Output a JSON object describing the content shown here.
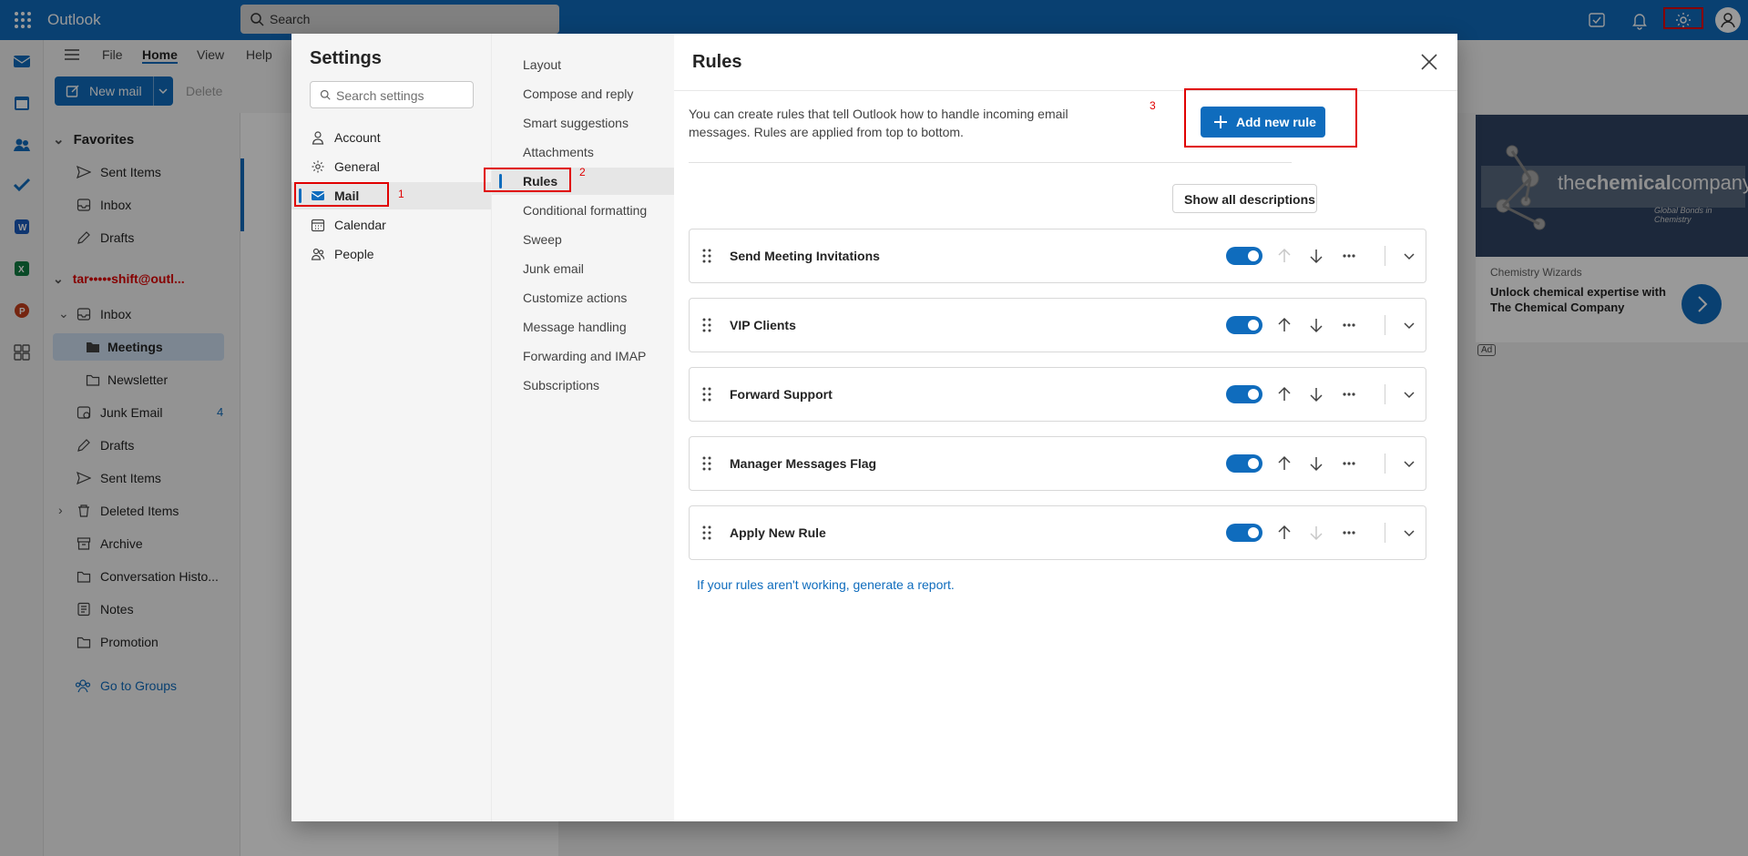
{
  "app": {
    "name": "Outlook",
    "search_placeholder": "Search"
  },
  "ribbon": {
    "tabs": [
      "File",
      "Home",
      "View",
      "Help"
    ],
    "new_mail": "New mail",
    "delete": "Delete"
  },
  "folders": {
    "favorites_label": "Favorites",
    "favorites": [
      "Sent Items",
      "Inbox",
      "Drafts"
    ],
    "account_label": "tar•••••shift@outl...",
    "items": [
      {
        "label": "Inbox",
        "icon": "inbox-icon"
      },
      {
        "label": "Meetings",
        "icon": "folder-icon",
        "selected": true
      },
      {
        "label": "Newsletter",
        "icon": "folder-icon"
      },
      {
        "label": "Junk Email",
        "icon": "junk-icon",
        "count": "4"
      },
      {
        "label": "Drafts",
        "icon": "pencil-icon"
      },
      {
        "label": "Sent Items",
        "icon": "send-icon"
      },
      {
        "label": "Deleted Items",
        "icon": "trash-icon"
      },
      {
        "label": "Archive",
        "icon": "archive-icon"
      },
      {
        "label": "Conversation Histo...",
        "icon": "folder-icon"
      },
      {
        "label": "Notes",
        "icon": "notes-icon"
      },
      {
        "label": "Promotion",
        "icon": "folder-icon"
      }
    ],
    "go_to_groups": "Go to Groups"
  },
  "ad": {
    "brand_light": "the",
    "brand_bold": "chemical",
    "brand_tail": "company",
    "tagline": "Global Bonds in Chemistry",
    "source": "Chemistry Wizards",
    "headline": "Unlock chemical expertise with The Chemical Company",
    "badge": "Ad"
  },
  "settings": {
    "title": "Settings",
    "search_placeholder": "Search settings",
    "categories": [
      {
        "label": "Account",
        "icon": "person-icon"
      },
      {
        "label": "General",
        "icon": "gear-icon"
      },
      {
        "label": "Mail",
        "icon": "mail-icon",
        "selected": true
      },
      {
        "label": "Calendar",
        "icon": "calendar-icon"
      },
      {
        "label": "People",
        "icon": "people-icon"
      }
    ],
    "mail_sections": [
      "Layout",
      "Compose and reply",
      "Smart suggestions",
      "Attachments",
      "Rules",
      "Conditional formatting",
      "Sweep",
      "Junk email",
      "Customize actions",
      "Message handling",
      "Forwarding and IMAP",
      "Subscriptions"
    ],
    "selected_section": "Rules"
  },
  "rules": {
    "title": "Rules",
    "description": "You can create rules that tell Outlook how to handle incoming email messages. Rules are applied from top to bottom.",
    "add_button": "Add new rule",
    "show_all": "Show all descriptions",
    "items": [
      {
        "name": "Send Meeting Invitations",
        "enabled": true,
        "can_move_up": false,
        "can_move_down": true
      },
      {
        "name": "VIP Clients",
        "enabled": true,
        "can_move_up": true,
        "can_move_down": true
      },
      {
        "name": "Forward Support",
        "enabled": true,
        "can_move_up": true,
        "can_move_down": true
      },
      {
        "name": "Manager Messages Flag",
        "enabled": true,
        "can_move_up": true,
        "can_move_down": true
      },
      {
        "name": "Apply New Rule",
        "enabled": true,
        "can_move_up": true,
        "can_move_down": false
      }
    ],
    "report_link": "If your rules aren't working, generate a report."
  },
  "annotations": [
    "1",
    "2",
    "3"
  ],
  "colors": {
    "brand": "#0f6cbd",
    "highlight": "#e00000"
  }
}
